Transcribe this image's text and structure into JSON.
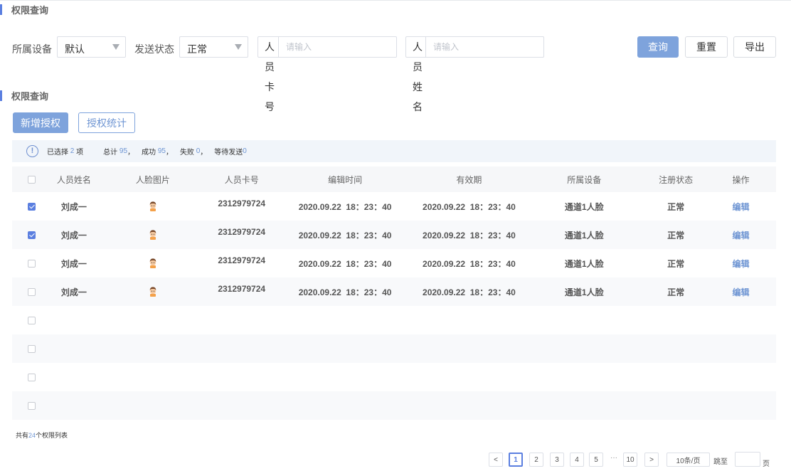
{
  "sections": {
    "query_title": "权限查询",
    "list_title": "权限查询"
  },
  "filters": {
    "device_label": "所属设备",
    "device_value": "默认",
    "send_status_label": "发送状态",
    "send_status_value": "正常",
    "card_label": "人员卡号",
    "card_placeholder": "请输入",
    "name_label": "人员姓名",
    "name_placeholder": "请输入"
  },
  "actions": {
    "query": "查询",
    "reset": "重置",
    "export": "导出",
    "add_auth": "新增授权",
    "auth_stats": "授权统计"
  },
  "summary": {
    "selected_prefix": "已选择",
    "selected_count": "2",
    "selected_suffix": "项",
    "total_label": "总计",
    "total_value": "95",
    "success_label": "成功",
    "success_value": "95",
    "fail_label": "失败",
    "fail_value": "0",
    "pending_label": "等待发送",
    "pending_value": "0",
    "sep": "，"
  },
  "table": {
    "headers": [
      "人员姓名",
      "人脸图片",
      "人员卡号",
      "编辑时间",
      "有效期",
      "所属设备",
      "注册状态",
      "操作"
    ],
    "rows": [
      {
        "checked": true,
        "name": "刘成一",
        "card": "2312979724",
        "edit_time": "2020.09.22  18：23：40",
        "valid": "2020.09.22  18：23：40",
        "device": "通道1人脸",
        "status": "正常",
        "op": "编辑"
      },
      {
        "checked": true,
        "name": "刘成一",
        "card": "2312979724",
        "edit_time": "2020.09.22  18：23：40",
        "valid": "2020.09.22  18：23：40",
        "device": "通道1人脸",
        "status": "正常",
        "op": "编辑"
      },
      {
        "checked": false,
        "name": "刘成一",
        "card": "2312979724",
        "edit_time": "2020.09.22  18：23：40",
        "valid": "2020.09.22  18：23：40",
        "device": "通道1人脸",
        "status": "正常",
        "op": "编辑"
      },
      {
        "checked": false,
        "name": "刘成一",
        "card": "2312979724",
        "edit_time": "2020.09.22  18：23：40",
        "valid": "2020.09.22  18：23：40",
        "device": "通道1人脸",
        "status": "正常",
        "op": "编辑"
      }
    ],
    "empty_rows": 4
  },
  "footer": {
    "total_prefix": "共有",
    "total_count": "24",
    "total_suffix": "个权限列表"
  },
  "pagination": {
    "prev": "<",
    "pages": [
      "1",
      "2",
      "3",
      "4",
      "5"
    ],
    "current": "1",
    "ellipsis": "···",
    "last": "10",
    "next": ">",
    "page_size": "10条/页",
    "jump_label": "跳至",
    "page_unit": "页"
  },
  "colors": {
    "accent": "#5b7fe0",
    "primary_button": "#7ea3dc",
    "link": "#6e95d3"
  }
}
